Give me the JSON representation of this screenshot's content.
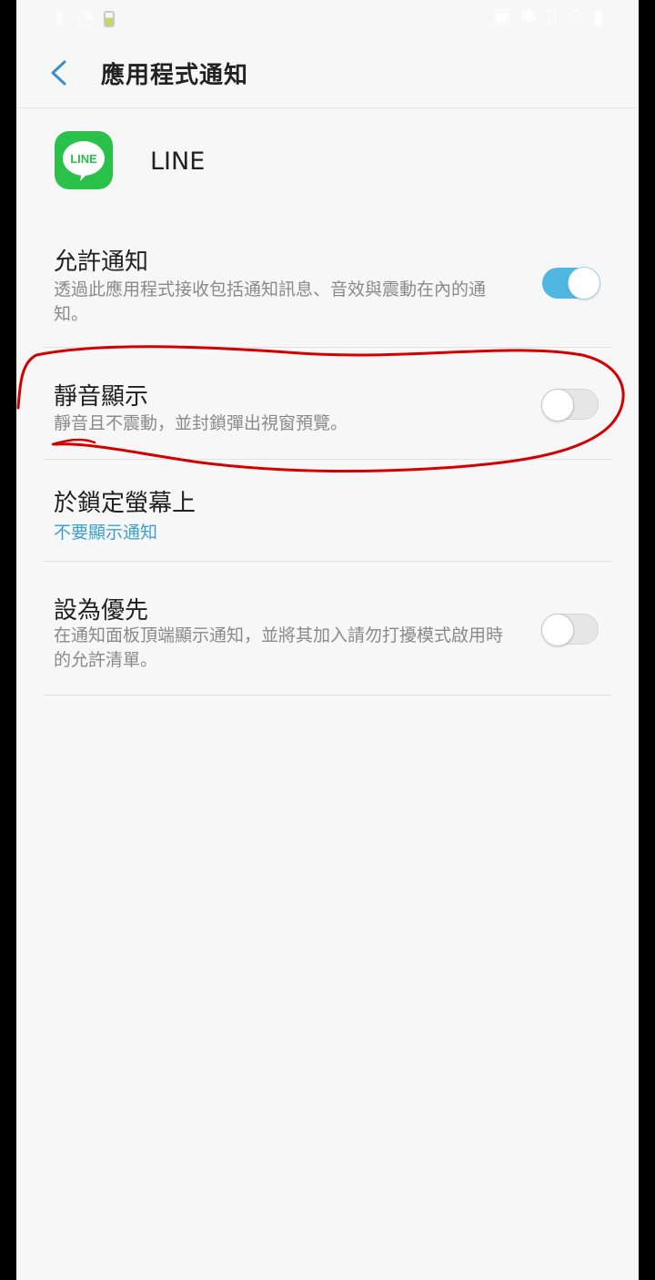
{
  "header": {
    "title": "應用程式通知"
  },
  "app": {
    "name": "LINE",
    "icon_label": "LINE",
    "icon_color": "#29c14a"
  },
  "settings": {
    "allow": {
      "title": "允許通知",
      "desc": "透過此應用程式接收包括通知訊息、音效與震動在內的通知。",
      "enabled": true
    },
    "silent": {
      "title": "靜音顯示",
      "desc": "靜音且不震動，並封鎖彈出視窗預覽。",
      "enabled": false
    },
    "lockscreen": {
      "title": "於鎖定螢幕上",
      "value": "不要顯示通知"
    },
    "priority": {
      "title": "設為優先",
      "desc": "在通知面板頂端顯示通知，並將其加入請勿打擾模式啟用時的允許清單。",
      "enabled": false
    }
  },
  "colors": {
    "accent": "#4fb7e2",
    "link": "#3ca0cf",
    "annotation": "#d40000"
  }
}
